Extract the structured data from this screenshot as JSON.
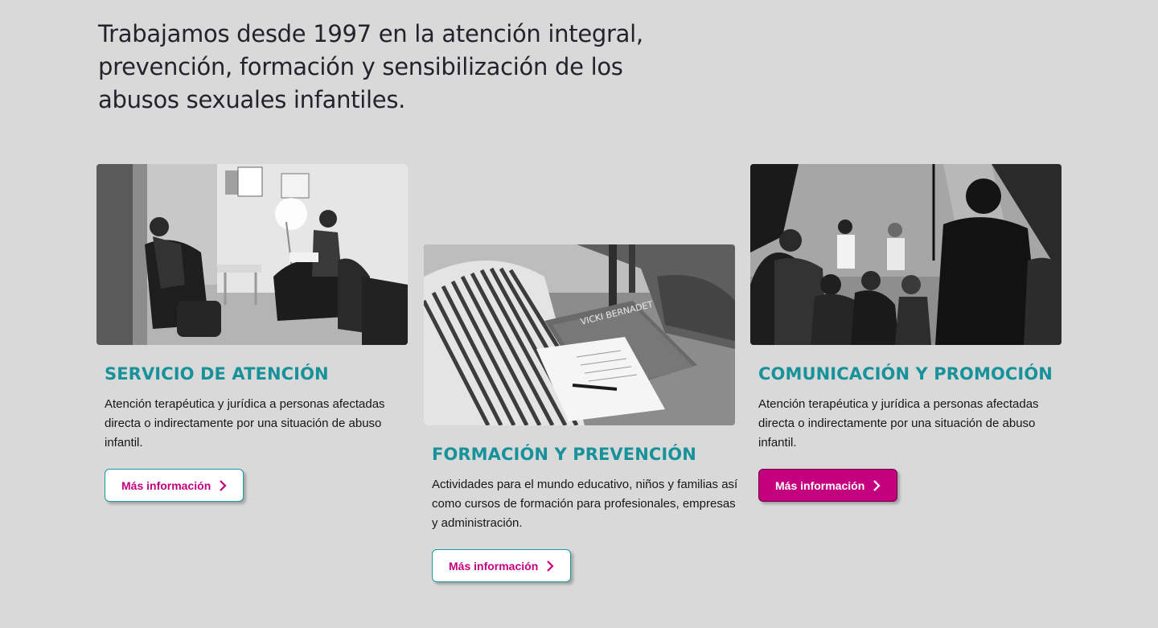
{
  "intro": {
    "text": "Trabajamos desde 1997 en la atención integral, prevención, formación y sensibilización de los abusos sexuales infantiles."
  },
  "cards": [
    {
      "title": "SERVICIO DE ATENCIÓN",
      "description": "Atención terapéutica y jurídica a personas afectadas directa o indirectamente por una situación de abuso infantil.",
      "button": "Más información",
      "image": "therapy-session-photo"
    },
    {
      "title": "FORMACIÓN Y PREVENCIÓN",
      "description": "Actividades para el mundo educativo, niños y familias así como cursos de formación para profesionales, empresas y administración.",
      "button": "Más información",
      "image": "book-and-notebook-photo",
      "book_text": "VICKI BERNADET"
    },
    {
      "title": "COMUNICACIÓN Y PROMOCIÓN",
      "description": "Atención terapéutica y jurídica a personas afectadas directa o indirectamente por una situación de abuso infantil.",
      "button": "Más información",
      "image": "public-talk-photo"
    }
  ],
  "colors": {
    "background": "#d9d9d9",
    "heading_teal": "#17929b",
    "accent_magenta": "#c5007f"
  }
}
